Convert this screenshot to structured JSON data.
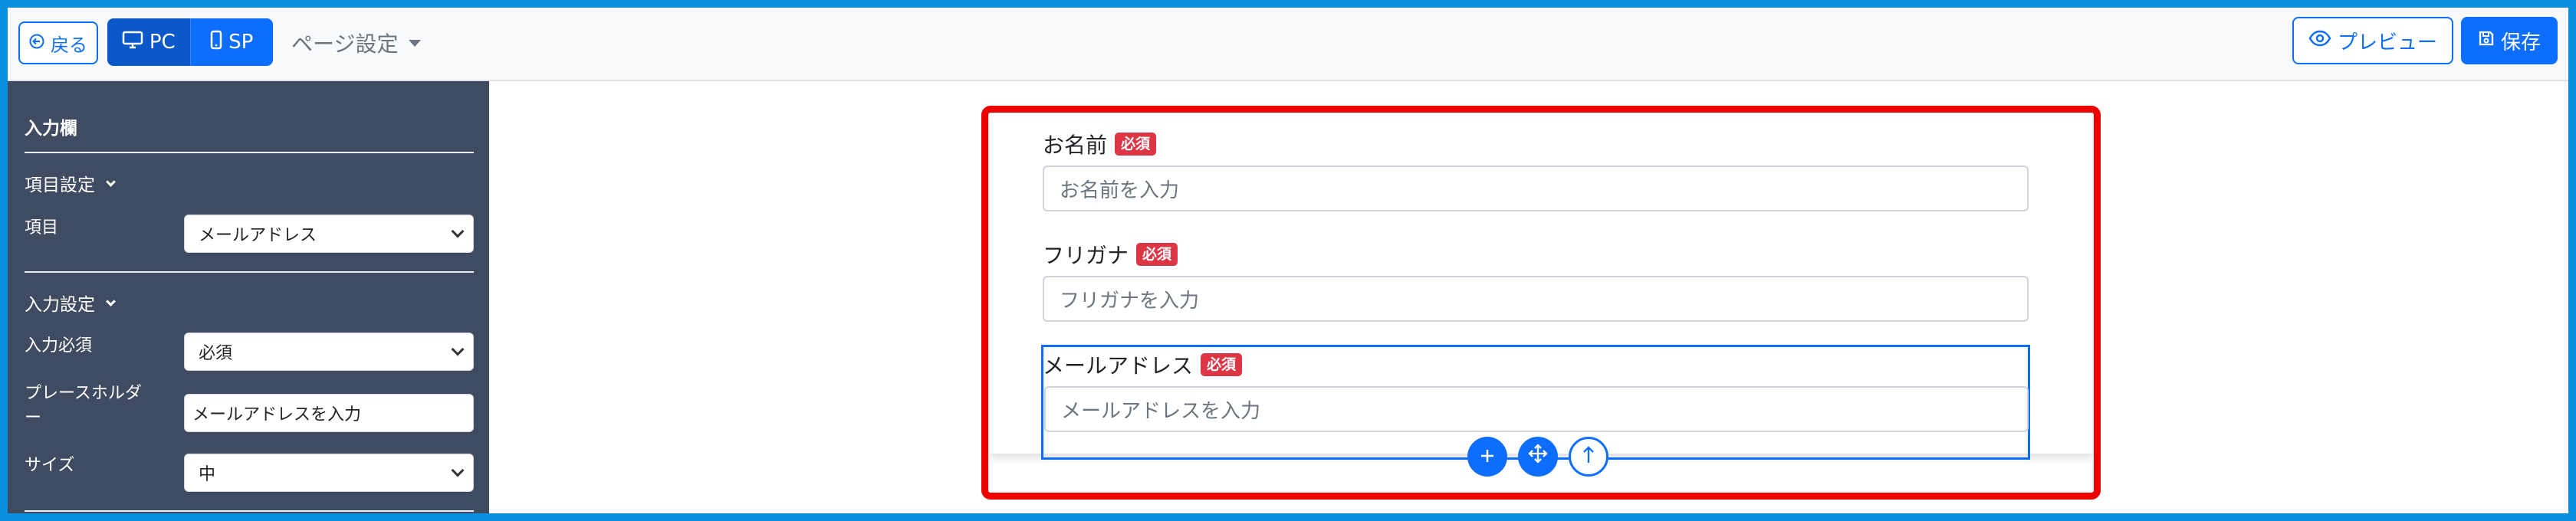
{
  "toolbar": {
    "back_label": "戻る",
    "pc_label": "PC",
    "sp_label": "SP",
    "page_settings_label": "ページ設定",
    "preview_label": "プレビュー",
    "save_label": "保存"
  },
  "sidebar": {
    "title": "入力欄",
    "item_section": "項目設定",
    "item_label": "項目",
    "item_value": "メールアドレス",
    "input_section": "入力設定",
    "required_label": "入力必須",
    "required_value": "必須",
    "placeholder_label_line1": "プレースホルダ",
    "placeholder_label_line2": "ー",
    "placeholder_value": "メールアドレスを入力",
    "size_label": "サイズ",
    "size_value": "中"
  },
  "form": {
    "required_badge": "必須",
    "fields": [
      {
        "label": "お名前",
        "placeholder": "お名前を入力"
      },
      {
        "label": "フリガナ",
        "placeholder": "フリガナを入力"
      },
      {
        "label": "メールアドレス",
        "placeholder": "メールアドレスを入力"
      }
    ]
  },
  "colors": {
    "primary": "#0d6efd",
    "sidebar_bg": "#3f4b60",
    "danger": "#dc3545",
    "highlight_red": "#ee0000",
    "outer_border": "#0a8fe0"
  },
  "icons": {
    "back": "arrow-left-icon",
    "pc": "monitor-icon",
    "sp": "phone-icon",
    "preview": "eye-icon",
    "save": "floppy-disk-icon",
    "add": "plus-icon",
    "move": "move-arrows-icon",
    "up": "arrow-up-icon"
  }
}
